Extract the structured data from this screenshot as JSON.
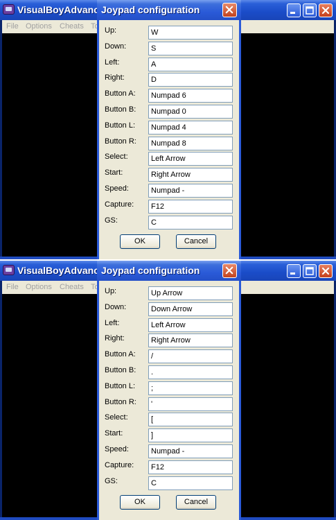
{
  "panels": [
    {
      "main_window": {
        "title": "VisualBoyAdvance",
        "menu": [
          "File",
          "Options",
          "Cheats",
          "To"
        ]
      },
      "dialog": {
        "title": "Joypad configuration",
        "rows": [
          {
            "label": "Up:",
            "value": "W"
          },
          {
            "label": "Down:",
            "value": "S"
          },
          {
            "label": "Left:",
            "value": "A"
          },
          {
            "label": "Right:",
            "value": "D"
          },
          {
            "label": "Button A:",
            "value": "Numpad 6"
          },
          {
            "label": "Button B:",
            "value": "Numpad 0"
          },
          {
            "label": "Button L:",
            "value": "Numpad 4"
          },
          {
            "label": "Button R:",
            "value": "Numpad 8"
          },
          {
            "label": "Select:",
            "value": "Left Arrow"
          },
          {
            "label": "Start:",
            "value": "Right Arrow"
          },
          {
            "label": "Speed:",
            "value": "Numpad -"
          },
          {
            "label": "Capture:",
            "value": "F12"
          },
          {
            "label": "GS:",
            "value": "C"
          }
        ],
        "ok_label": "OK",
        "cancel_label": "Cancel"
      }
    },
    {
      "main_window": {
        "title": "VisualBoyAdvance",
        "menu": [
          "File",
          "Options",
          "Cheats",
          "To"
        ]
      },
      "dialog": {
        "title": "Joypad configuration",
        "rows": [
          {
            "label": "Up:",
            "value": "Up Arrow"
          },
          {
            "label": "Down:",
            "value": "Down Arrow"
          },
          {
            "label": "Left:",
            "value": "Left Arrow"
          },
          {
            "label": "Right:",
            "value": "Right Arrow"
          },
          {
            "label": "Button A:",
            "value": "/"
          },
          {
            "label": "Button B:",
            "value": "."
          },
          {
            "label": "Button L:",
            "value": ";"
          },
          {
            "label": "Button R:",
            "value": "'"
          },
          {
            "label": "Select:",
            "value": "["
          },
          {
            "label": "Start:",
            "value": "]"
          },
          {
            "label": "Speed:",
            "value": "Numpad -"
          },
          {
            "label": "Capture:",
            "value": "F12"
          },
          {
            "label": "GS:",
            "value": "C"
          }
        ],
        "ok_label": "OK",
        "cancel_label": "Cancel"
      }
    }
  ],
  "colors": {
    "titlebar_blue": "#2a5ad8",
    "close_red": "#c4401c",
    "dialog_face": "#ece9d8",
    "field_border": "#7f9db9",
    "menu_disabled": "#a0a0a0"
  },
  "icons": [
    "app-icon",
    "minimize-icon",
    "maximize-icon",
    "close-icon"
  ]
}
